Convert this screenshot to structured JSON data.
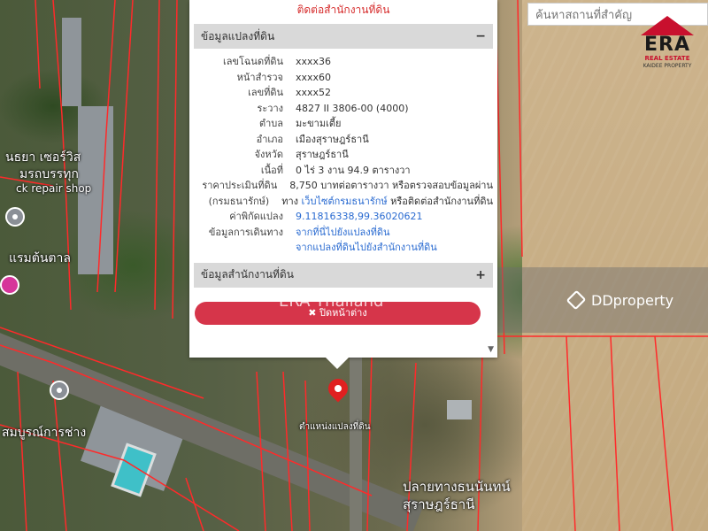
{
  "map": {
    "labels": {
      "shop_line1": "นธยา เซอร์วิส",
      "shop_line2": "มรถบรรทุก",
      "shop_line3": "ck repair shop",
      "resort": "แรมต้นตาล",
      "garage": "สมบูรณ์การช่าง",
      "marker_caption": "ตำแหน่งแปลงที่ดิน",
      "road_label1": "ปลายทางธนนันทน์",
      "road_label2": "สุราษฎร์ธานี"
    },
    "search": {
      "placeholder": "ค้นหาสถานที่สำคัญ"
    }
  },
  "logo": {
    "letters": "ERA",
    "line1": "REAL ESTATE",
    "line2": "KAIDEE PROPERTY"
  },
  "panel": {
    "top_link": "ติดต่อสำนักงานที่ดิน",
    "section1_title": "ข้อมูลแปลงที่ดิน",
    "section1_symbol": "−",
    "rows": [
      {
        "label": "เลขโฉนดที่ดิน",
        "value": "xxxx36"
      },
      {
        "label": "หน้าสำรวจ",
        "value": "xxxx60"
      },
      {
        "label": "เลขที่ดิน",
        "value": "xxxx52"
      },
      {
        "label": "ระวาง",
        "value": "4827 II 3806-00 (4000)"
      },
      {
        "label": "ตำบล",
        "value": "มะขามเตี้ย"
      },
      {
        "label": "อำเภอ",
        "value": "เมืองสุราษฎร์ธานี"
      },
      {
        "label": "จังหวัด",
        "value": "สุราษฎร์ธานี"
      },
      {
        "label": "เนื้อที่",
        "value": "0 ไร่ 3 งาน 94.9 ตารางวา"
      },
      {
        "label": "ราคาประเมินที่ดิน",
        "value": "8,750 บาทต่อตารางวา หรือตรวจสอบข้อมูลผ่าน"
      },
      {
        "label": "(กรมธนารักษ์)",
        "value_prefix": "ทาง ",
        "value_link": "เว็บไซต์กรมธนารักษ์",
        "value_suffix": " หรือติดต่อสำนักงานที่ดิน"
      },
      {
        "label": "ค่าพิกัดแปลง",
        "value": "9.11816338,99.36020621"
      },
      {
        "label": "ข้อมูลการเดินทาง",
        "value": "จากที่นี่ไปยังแปลงที่ดิน"
      },
      {
        "label": "",
        "value": "จากแปลงที่ดินไปยังสำนักงานที่ดิน"
      }
    ],
    "section2_title": "ข้อมูลสำนักงานที่ดิน",
    "section2_symbol": "+",
    "close_label": "✖ ปิดหน้าต่าง",
    "scroll_arrow": "▼"
  },
  "watermark": {
    "era_text": "ERA Thailand",
    "dd_text": "DDproperty"
  },
  "colors": {
    "accent_red": "#d6354a",
    "link_blue": "#2a6bd1",
    "parcel_line": "#ff2a2a"
  }
}
